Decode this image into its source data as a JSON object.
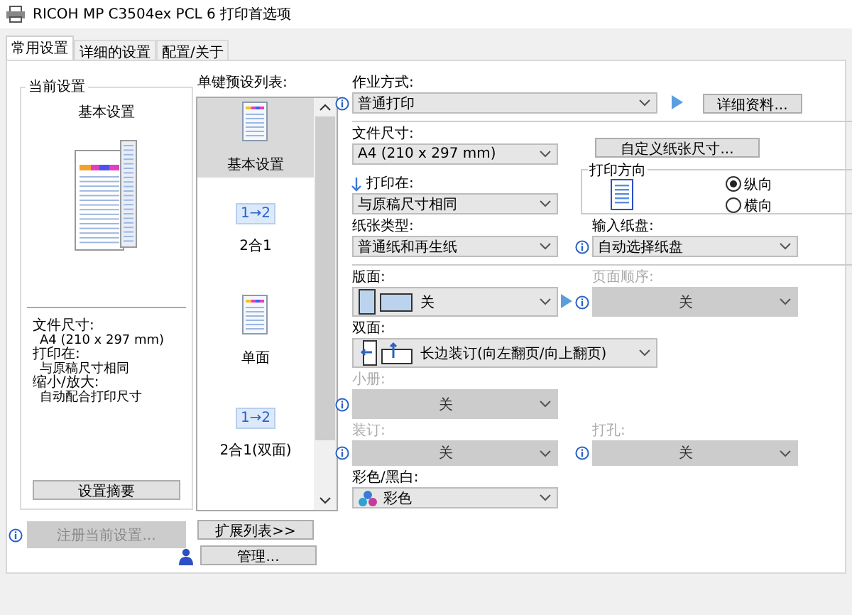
{
  "window": {
    "title": "RICOH MP C3504ex PCL 6 打印首选项"
  },
  "tabs": [
    {
      "label": "常用设置",
      "selected": true
    },
    {
      "label": "详细的设置",
      "selected": false
    },
    {
      "label": "配置/关于",
      "selected": false
    }
  ],
  "current_settings": {
    "title": "当前设置",
    "preset_name": "基本设置",
    "details": [
      {
        "label": "文件尺寸:",
        "value": "A4 (210 x 297 mm)"
      },
      {
        "label": "打印在:",
        "value": "与原稿尺寸相同"
      },
      {
        "label": "缩小/放大:",
        "value": "自动配合打印尺寸"
      }
    ],
    "summary_button": "设置摘要",
    "register_button": {
      "label": "注册当前设置...",
      "disabled": true
    }
  },
  "presets": {
    "title": "单键预设列表:",
    "items": [
      {
        "label": "基本设置",
        "kind": "document",
        "selected": true
      },
      {
        "label": "2合1",
        "kind": "two-up",
        "icon_text": "1→2",
        "selected": false
      },
      {
        "label": "单面",
        "kind": "document",
        "selected": false
      },
      {
        "label": "2合1(双面)",
        "kind": "two-up",
        "icon_text": "1→2",
        "selected": false
      }
    ],
    "expand_button": "扩展列表>>",
    "manage_button": "管理..."
  },
  "job_type": {
    "label": "作业方式:",
    "value": "普通打印",
    "info": true,
    "disabled": false
  },
  "details_button": "详细资料...",
  "document_size": {
    "label": "文件尺寸:",
    "value": "A4 (210 x 297 mm)",
    "info": false,
    "disabled": false
  },
  "custom_size_button": "自定义纸张尺寸...",
  "print_on": {
    "label": "打印在:",
    "value": "与原稿尺寸相同"
  },
  "orientation": {
    "title": "打印方向",
    "options": [
      {
        "label": "纵向",
        "selected": true
      },
      {
        "label": "横向",
        "selected": false
      }
    ]
  },
  "paper_type": {
    "label": "纸张类型:",
    "value": "普通纸和再生纸",
    "info": false,
    "disabled": false
  },
  "input_tray": {
    "label": "输入纸盘:",
    "value": "自动选择纸盘",
    "info": true,
    "disabled": false
  },
  "layout": {
    "label": "版面:",
    "value": "关",
    "info": false,
    "disabled": false
  },
  "page_order": {
    "label": "页面顺序:",
    "value": "关",
    "info": true,
    "disabled": true
  },
  "duplex": {
    "label": "双面:",
    "value": "长边装订(向左翻页/向上翻页)",
    "info": false,
    "disabled": false
  },
  "booklet": {
    "label": "小册:",
    "value": "关",
    "info": true,
    "disabled": true
  },
  "staple": {
    "label": "装订:",
    "value": "关",
    "info": true,
    "disabled": true
  },
  "punch": {
    "label": "打孔:",
    "value": "关",
    "info": true,
    "disabled": true
  },
  "color_mode": {
    "label": "彩色/黑白:",
    "value": "彩色",
    "info": false,
    "disabled": false
  }
}
